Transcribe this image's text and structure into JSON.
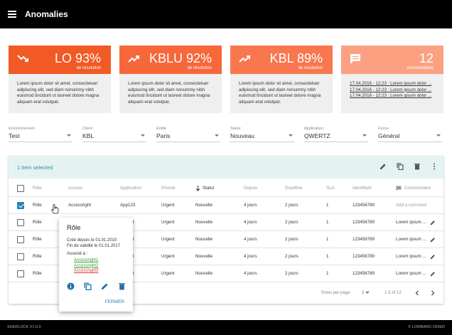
{
  "header": {
    "title": "Anomalies"
  },
  "cards": [
    {
      "value": "LO 93%",
      "sub": "de résolution",
      "color": "#f15a24",
      "icon": "trend-down-icon",
      "text": "Lorem ipsum dolor sit amet, consectetuer adipiscing elit, sed diam nonummy nibh euismod tincidunt ut laoreet dolore magna aliquam erat volutpat."
    },
    {
      "value": "KBLU 92%",
      "sub": "de résolution",
      "color": "#f7673a",
      "icon": "trend-up-icon",
      "text": "Lorem ipsum dolor sit amet, consectetuer adipiscing elit, sed diam nonummy nibh euismod tincidunt ut laoreet dolore magna aliquam erat volutpat."
    },
    {
      "value": "KBL 89%",
      "sub": "de résolution",
      "color": "#f9774f",
      "icon": "trend-up-icon",
      "text": "Lorem ipsum dolor sit amet, consectetuer adipiscing elit, sed diam nonummy nibh euismod tincidunt ut laoreet dolore magna aliquam erat volutpat."
    },
    {
      "value": "12",
      "sub": "commentaires",
      "color": "#fba182",
      "icon": "comment-icon",
      "comments": [
        "17.04.2016 - 12:23 : Lorem ipsum dolor ...",
        "17.04.2016 - 12:23 : Lorem ipsum dolor ...",
        "17.04.2016 - 12:23 : Lorem ipsum dolor ..."
      ]
    }
  ],
  "filters": [
    {
      "label": "Environnement",
      "value": "Test"
    },
    {
      "label": "Client",
      "value": "KBL"
    },
    {
      "label": "Entité",
      "value": "Paris"
    },
    {
      "label": "Statut",
      "value": "Nouveau"
    },
    {
      "label": "Application",
      "value": "QWERTZ"
    },
    {
      "label": "Focus",
      "value": "Général"
    }
  ],
  "table": {
    "selection": "1 item selected",
    "columns": [
      "Rôle",
      "Access",
      "Application",
      "Priorité",
      "Statut",
      "Depuis",
      "Deadline",
      "SLA",
      "Identifiant",
      "Commentaire"
    ],
    "rows": [
      {
        "checked": true,
        "role": "Rôle",
        "access": "Accessright",
        "app": "App123",
        "prio": "Urgent",
        "statut": "Nouvelle",
        "depuis": "4 jours",
        "deadline": "2 jours",
        "sla": "1",
        "id": "123456789",
        "comment": "Add a comment",
        "edit": false
      },
      {
        "checked": false,
        "role": "Rôle",
        "access": "",
        "app": "3",
        "prio": "Urgent",
        "statut": "Nouvelle",
        "depuis": "4 jours",
        "deadline": "2 jours",
        "sla": "1",
        "id": "123456789",
        "comment": "Lorem ipsum ...",
        "edit": true
      },
      {
        "checked": false,
        "role": "Rôle",
        "access": "",
        "app": "3",
        "prio": "Urgent",
        "statut": "Nouvelle",
        "depuis": "4 jours",
        "deadline": "2 jours",
        "sla": "1",
        "id": "123456789",
        "comment": "Lorem ipsum ...",
        "edit": true
      },
      {
        "checked": false,
        "role": "Rôle",
        "access": "",
        "app": "3",
        "prio": "Urgent",
        "statut": "Nouvelle",
        "depuis": "4 jours",
        "deadline": "2 jours",
        "sla": "1",
        "id": "123456789",
        "comment": "Lorem ipsum ...",
        "edit": true
      },
      {
        "checked": false,
        "role": "Rôle",
        "access": "",
        "app": "3",
        "prio": "Urgent",
        "statut": "Nouvelle",
        "depuis": "4 jours",
        "deadline": "2 jours",
        "sla": "1",
        "id": "123456789",
        "comment": "Lorem ipsum ...",
        "edit": true
      }
    ],
    "pager": {
      "rows_label": "Rows per page:",
      "rows_value": "5",
      "range": "1-5 of 12"
    }
  },
  "popup": {
    "title": "Rôle",
    "created": "Créé depuis le 01.01.2010",
    "validity": "Fin de validité le 01.01.2017",
    "associated_label": "Associé à :",
    "links": [
      {
        "text": "Accessright1",
        "color": "#3a9d3a"
      },
      {
        "text": "Accessright2",
        "color": "#3a9d3a"
      },
      {
        "text": "Accessright3",
        "color": "#e03c2c"
      }
    ],
    "close": "FERMER"
  },
  "footer": {
    "left": "SHERLOCK V1.0.0",
    "right": "© LOMBARD ODIER"
  }
}
